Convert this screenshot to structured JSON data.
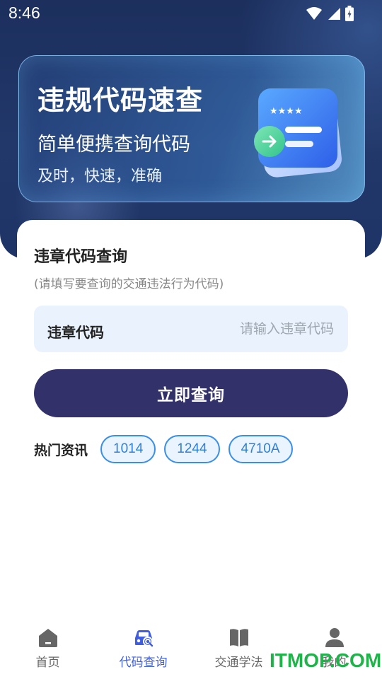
{
  "status_bar": {
    "time": "8:46",
    "icons": [
      "wifi-icon",
      "signal-icon",
      "battery-icon"
    ]
  },
  "banner": {
    "title": "违规代码速查",
    "subtitle": "简单便携查询代码",
    "tagline": "及时，快速，准确",
    "stars": "★★★★"
  },
  "query": {
    "title": "违章代码查询",
    "hint": "(请填写要查询的交通违法行为代码)",
    "input_label": "违章代码",
    "input_placeholder": "请输入违章代码",
    "input_value": "",
    "button_label": "立即查询"
  },
  "hot": {
    "label": "热门资讯",
    "tags": [
      "1014",
      "1244",
      "4710A"
    ]
  },
  "nav": {
    "items": [
      {
        "label": "首页",
        "icon": "home-icon",
        "active": false
      },
      {
        "label": "代码查询",
        "icon": "car-search-icon",
        "active": true
      },
      {
        "label": "交通学法",
        "icon": "book-icon",
        "active": false
      },
      {
        "label": "我的",
        "icon": "user-icon",
        "active": false
      }
    ]
  },
  "watermark": "ITMOP.COM",
  "colors": {
    "header_bg": "#1e3466",
    "primary_button": "#33316a",
    "tag_border": "#3a8ee8",
    "nav_active": "#3f5fe0",
    "watermark": "#22b24c"
  }
}
